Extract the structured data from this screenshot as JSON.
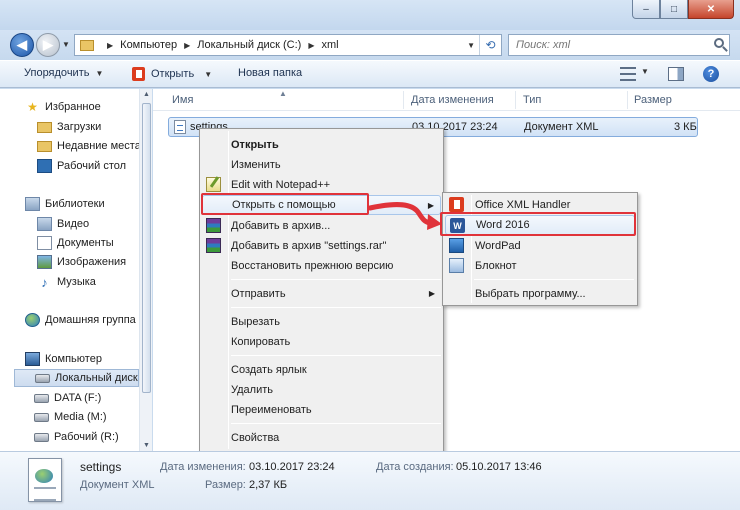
{
  "window": {
    "minimize": "–",
    "maximize": "□",
    "close": "✕"
  },
  "address": {
    "crumbs": [
      "Компьютер",
      "Локальный диск (C:)",
      "xml"
    ],
    "search_placeholder": "Поиск: xml"
  },
  "toolbar": {
    "organize": "Упорядочить",
    "open": "Открыть",
    "new_folder": "Новая папка",
    "help": "?"
  },
  "nav": {
    "favorites": "Избранное",
    "downloads": "Загрузки",
    "recent": "Недавние места",
    "desktop": "Рабочий стол",
    "libraries": "Библиотеки",
    "video": "Видео",
    "documents": "Документы",
    "images": "Изображения",
    "music": "Музыка",
    "homegroup": "Домашняя группа",
    "computer": "Компьютер",
    "local_disk": "Локальный диск",
    "data": "DATA (F:)",
    "media": "Media (M:)",
    "work": "Рабочий (R:)"
  },
  "columns": {
    "name": "Имя",
    "date": "Дата изменения",
    "type": "Тип",
    "size": "Размер"
  },
  "file": {
    "name": "settings",
    "date": "03.10.2017 23:24",
    "type": "Документ XML",
    "size": "3 КБ"
  },
  "context_menu": {
    "open": "Открыть",
    "edit": "Изменить",
    "notepadpp": "Edit with Notepad++",
    "open_with": "Открыть с помощью",
    "add_archive": "Добавить в архив...",
    "add_rar": "Добавить в архив \"settings.rar\"",
    "restore": "Восстановить прежнюю версию",
    "send_to": "Отправить",
    "cut": "Вырезать",
    "copy": "Копировать",
    "shortcut": "Создать ярлык",
    "delete": "Удалить",
    "rename": "Переименовать",
    "properties": "Свойства"
  },
  "submenu": {
    "office_xml": "Office XML Handler",
    "word": "Word 2016",
    "wordpad": "WordPad",
    "notepad": "Блокнот",
    "choose": "Выбрать программу..."
  },
  "details": {
    "name": "settings",
    "type": "Документ XML",
    "modified_label": "Дата изменения:",
    "modified_value": "03.10.2017 23:24",
    "size_label": "Размер:",
    "size_value": "2,37 КБ",
    "created_label": "Дата создания:",
    "created_value": "05.10.2017 13:46"
  },
  "colors": {
    "annotation": "#e0333a",
    "selection": "#d1e2f6",
    "office": "#dc3c1e",
    "word": "#2b579a"
  }
}
